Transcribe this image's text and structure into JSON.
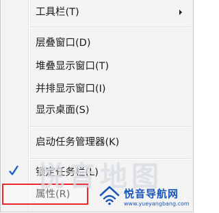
{
  "menu": {
    "items": [
      {
        "label": "工具栏(T)",
        "has_submenu": true
      },
      {
        "label": "层叠窗口(D)"
      },
      {
        "label": "堆叠显示窗口(T)"
      },
      {
        "label": "并排显示窗口(I)"
      },
      {
        "label": "显示桌面(S)"
      },
      {
        "label": "启动任务管理器(K)"
      },
      {
        "label": "锁定任务栏(L)",
        "checked": true
      },
      {
        "label": "属性(R)"
      }
    ],
    "submenu_icon": "triangle-right-icon",
    "check_icon": "checkmark-icon"
  },
  "watermark": {
    "overlay_text": "悦音地图",
    "logo_icon": "wifi-house-logo",
    "name": "悦音导航网",
    "url": "www.yueyangbang.com"
  },
  "colors": {
    "menu_bg": "#f3f3f3",
    "highlight_border": "#e8262b",
    "check": "#1e63c9",
    "logo": "#1a56b8"
  }
}
